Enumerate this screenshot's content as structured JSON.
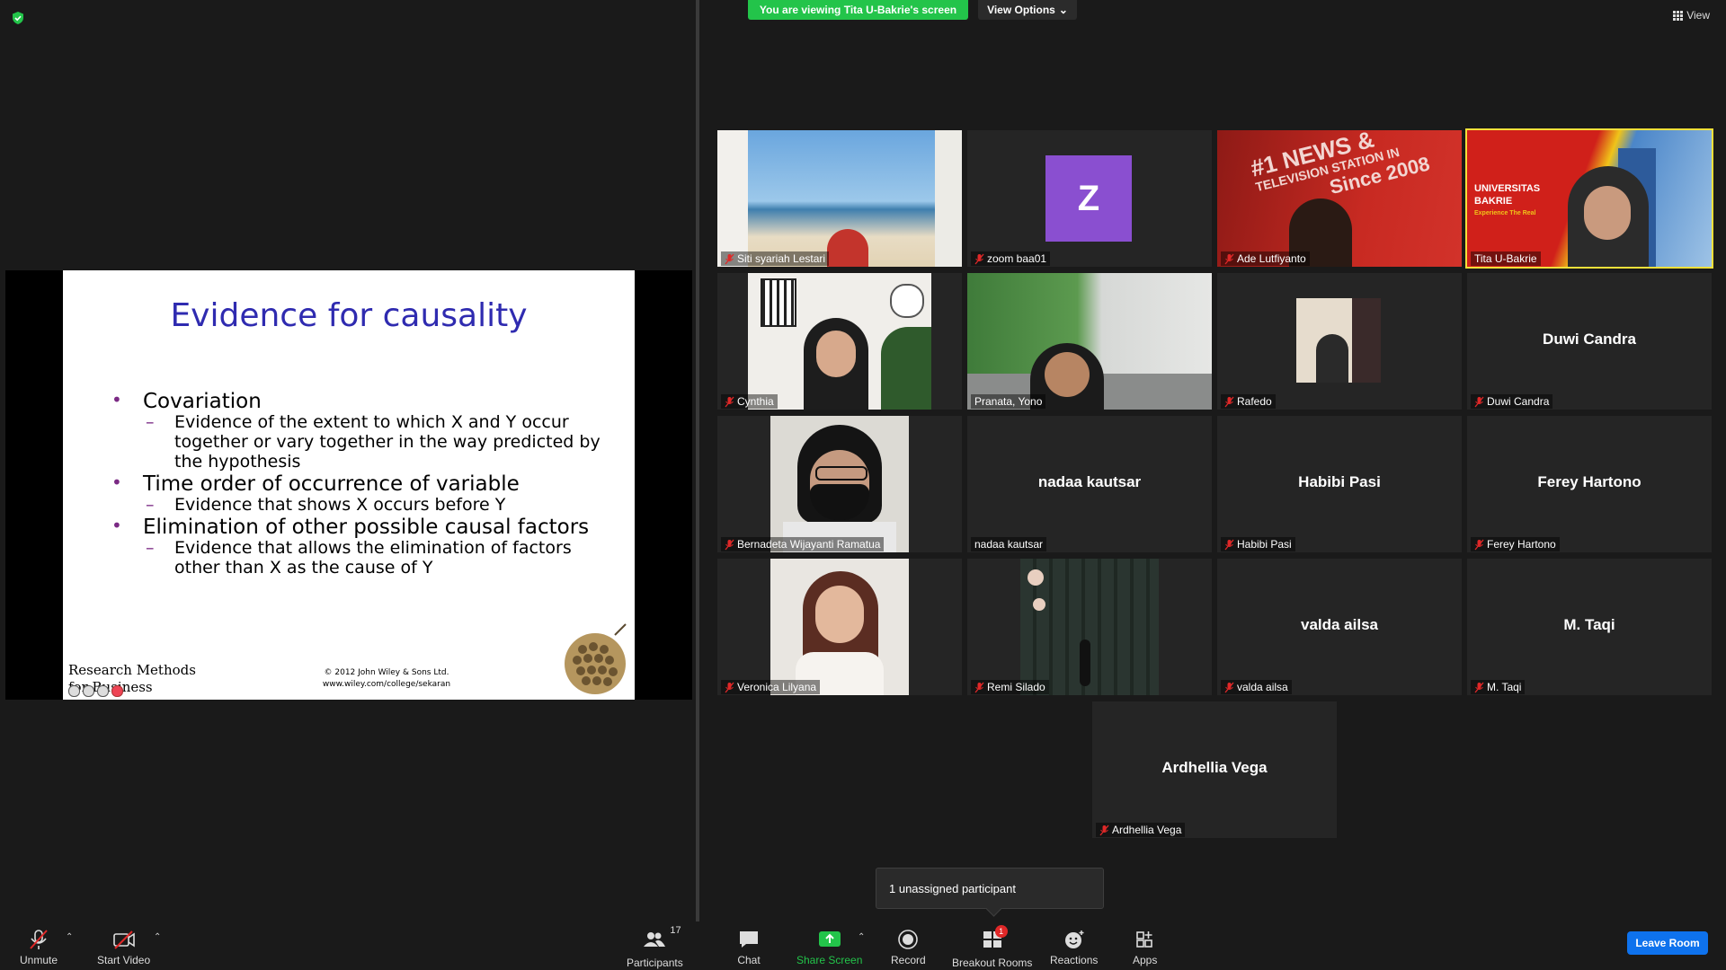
{
  "header": {
    "viewing_banner": "You are viewing Tita U-Bakrie's screen",
    "view_options": "View Options",
    "view": "View"
  },
  "slide": {
    "title": "Evidence for causality",
    "bullets": [
      {
        "text": "Covariation",
        "sub": [
          "Evidence of the extent to which X and Y occur together or vary together in the way predicted by the hypothesis"
        ]
      },
      {
        "text": "Time order of occurrence of variable",
        "sub": [
          "Evidence that shows X occurs before Y"
        ]
      },
      {
        "text": "Elimination of other possible causal factors",
        "sub": [
          "Evidence that allows the elimination of factors other than X as the cause of Y"
        ]
      }
    ],
    "footer_left_1": "Research Methods",
    "footer_left_2": "for Business",
    "copyright": "© 2012 John Wiley & Sons Ltd.",
    "url": "www.wiley.com/college/sekaran"
  },
  "participants": [
    {
      "name": "Siti syariah Lestari",
      "muted": true,
      "video": true
    },
    {
      "name": "zoom baa01",
      "muted": true,
      "video": false,
      "avatar_letter": "Z"
    },
    {
      "name": "Ade Lutfiyanto",
      "muted": true,
      "video": true,
      "bg_text_1": "#1 NEWS &",
      "bg_text_2": "TELEVISION STATION IN",
      "bg_text_3": "Since 2008"
    },
    {
      "name": "Tita U-Bakrie",
      "muted": false,
      "video": true,
      "active": true,
      "bg_text_1": "UNIVERSITAS",
      "bg_text_2": "BAKRIE",
      "bg_text_3": "Experience The Real"
    },
    {
      "name": "Cynthia",
      "muted": true,
      "video": true
    },
    {
      "name": "Pranata, Yono",
      "muted": false,
      "video": true
    },
    {
      "name": "Rafedo",
      "muted": true,
      "video": true
    },
    {
      "name": "Duwi Candra",
      "muted": true,
      "video": false
    },
    {
      "name": "Bernadeta Wijayanti Ramatua",
      "muted": true,
      "video": true
    },
    {
      "name": "nadaa kautsar",
      "muted": false,
      "video": false
    },
    {
      "name": "Habibi Pasi",
      "muted": true,
      "video": false
    },
    {
      "name": "Ferey Hartono",
      "muted": true,
      "video": false
    },
    {
      "name": "Veronica Lilyana",
      "muted": true,
      "video": true
    },
    {
      "name": "Remi Silado",
      "muted": true,
      "video": true
    },
    {
      "name": "valda ailsa",
      "muted": true,
      "video": false
    },
    {
      "name": "M. Taqi",
      "muted": true,
      "video": false
    },
    {
      "name": "Ardhellia Vega",
      "muted": true,
      "video": false
    }
  ],
  "tooltip": "1 unassigned participant",
  "toolbar": {
    "unmute": "Unmute",
    "start_video": "Start Video",
    "participants": "Participants",
    "participants_count": "17",
    "chat": "Chat",
    "share_screen": "Share Screen",
    "record": "Record",
    "breakout_rooms": "Breakout Rooms",
    "breakout_badge": "1",
    "reactions": "Reactions",
    "apps": "Apps",
    "leave_room": "Leave Room"
  },
  "colors": {
    "accent_green": "#23c44a",
    "active_speaker": "#f3e03a",
    "leave_blue": "#0e72ed",
    "avatar_purple": "#8a4fd0",
    "mute_red": "#e02828"
  }
}
